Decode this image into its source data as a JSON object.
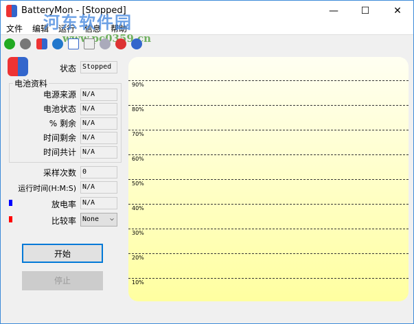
{
  "window": {
    "title": "BatteryMon - [Stopped]",
    "minimize": "—",
    "maximize": "☐",
    "close": "✕"
  },
  "menu": [
    "文件",
    "编辑",
    "运行",
    "信息",
    "帮助"
  ],
  "watermark": {
    "text1": "河东软件园",
    "text2": "www.pc0359.cn"
  },
  "toolbar": [
    "start-icon",
    "stop-icon",
    "battery-icon",
    "info-icon",
    "checklist-icon",
    "chart-icon",
    "settings-icon",
    "delete-icon",
    "help-icon"
  ],
  "status": {
    "label": "状态",
    "value": "Stopped"
  },
  "group": {
    "title": "电池资料",
    "rows": [
      {
        "label": "电源来源",
        "value": "N/A"
      },
      {
        "label": "电池状态",
        "value": "N/A"
      },
      {
        "label": "% 剩余",
        "value": "N/A"
      },
      {
        "label": "时间剩余",
        "value": "N/A"
      },
      {
        "label": "时间共计",
        "value": "N/A"
      }
    ]
  },
  "samples": {
    "label": "采样次数",
    "value": "0"
  },
  "runtime": {
    "label": "运行时间(H:M:S)",
    "value": "N/A"
  },
  "discharge": {
    "label": "放电率",
    "value": "N/A",
    "color": "#0000ff"
  },
  "compare": {
    "label": "比较率",
    "value": "None",
    "color": "#ff0000"
  },
  "buttons": {
    "start": "开始",
    "stop": "停止"
  },
  "chart": {
    "gridlines": [
      "90%",
      "80%",
      "70%",
      "60%",
      "50%",
      "40%",
      "30%",
      "20%",
      "10%"
    ]
  }
}
